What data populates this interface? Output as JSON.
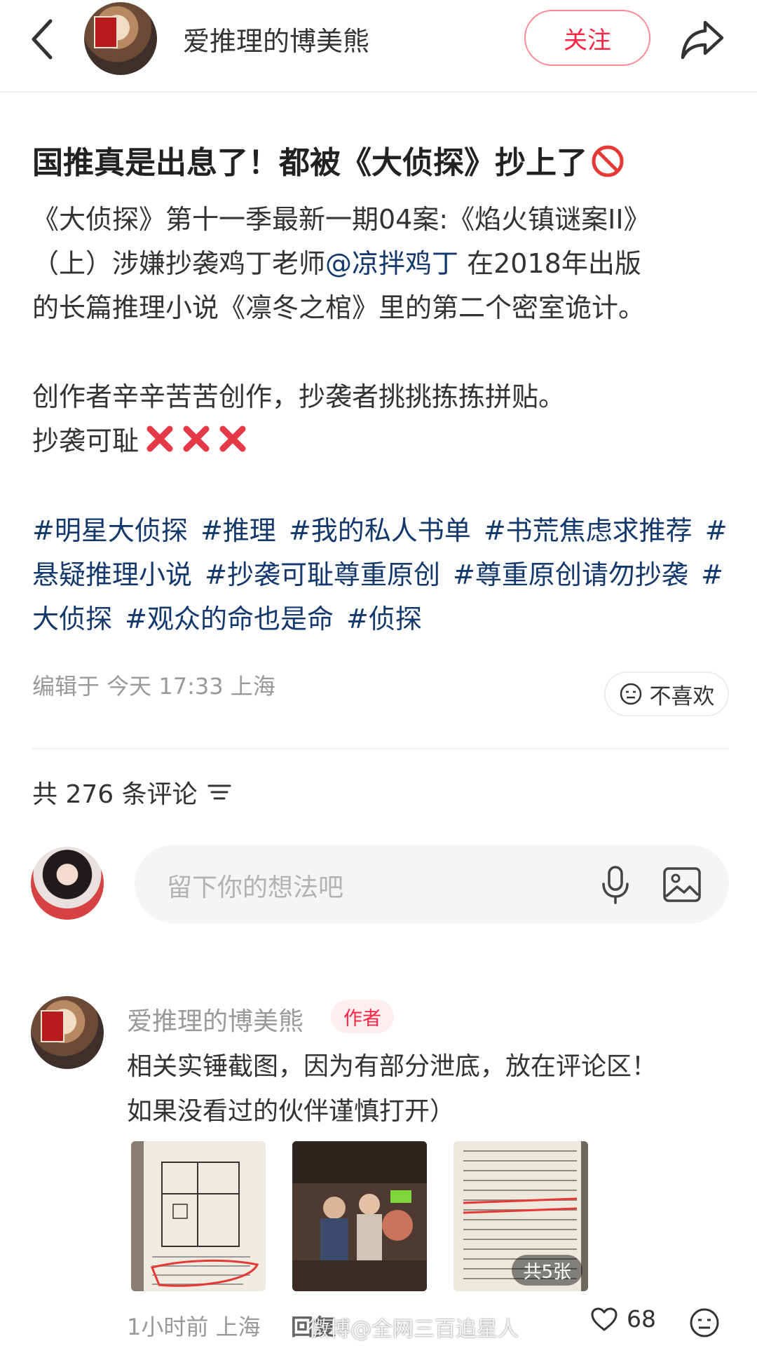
{
  "header": {
    "username": "爱推理的博美熊",
    "follow_label": "关注"
  },
  "post": {
    "title": "国推真是出息了！都被《大侦探》抄上了",
    "body_line1": "《大侦探》第十一季最新一期04案:《焰火镇谜案II》",
    "body_line2_pre": "（上）涉嫌抄袭鸡丁老师",
    "mention": "@凉拌鸡丁",
    "body_line2_post": " 在2018年出版",
    "body_line3": "的长篇推理小说《凛冬之棺》里的第二个密室诡计。",
    "body_line4": "创作者辛辛苦苦创作，抄袭者挑挑拣拣拼贴。",
    "body_line5": "抄袭可耻",
    "tags": [
      "#明星大侦探",
      "#推理",
      "#我的私人书单",
      "#书荒焦虑求推荐",
      "#悬疑推理小说",
      "#抄袭可耻尊重原创",
      "#尊重原创请勿抄袭",
      "#大侦探",
      "#观众的命也是命",
      "#侦探"
    ],
    "meta": "编辑于 今天 17:33 上海",
    "dislike_label": "不喜欢"
  },
  "comments_section": {
    "count_label": "共 276 条评论",
    "input_placeholder": "留下你的想法吧"
  },
  "comment": {
    "name": "爱推理的博美熊",
    "badge": "作者",
    "text_line1": "相关实锤截图，因为有部分泄底，放在评论区！",
    "text_line2": "如果没看过的伙伴谨慎打开）",
    "image_count": "共5张",
    "time_location": "1小时前 上海",
    "reply_label": "回复",
    "likes": "68"
  },
  "watermark": "微博@全网三百追星人",
  "colors": {
    "accent": "#ff2442",
    "link": "#13386c"
  }
}
